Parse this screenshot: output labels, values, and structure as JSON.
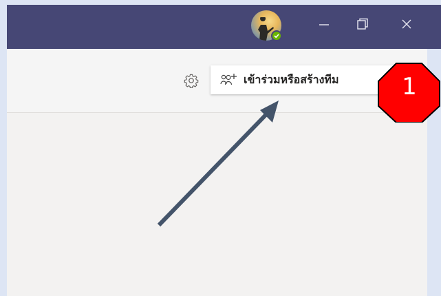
{
  "header": {
    "avatar_icon": "user-avatar-photo",
    "presence_status": "available",
    "presence_color": "#6bb700",
    "minimize_icon": "minimize-icon",
    "restore_icon": "restore-icon",
    "close_icon": "close-icon",
    "accent_color": "#464775"
  },
  "toolbar": {
    "settings_icon": "gear-icon",
    "join_create_team_label": "เข้าร่วมหรือสร้างทีม",
    "join_create_team_icon": "people-add-icon"
  },
  "annotation": {
    "step_number": "1",
    "callout_color": "#ff0000",
    "arrow_color": "#44546a"
  }
}
